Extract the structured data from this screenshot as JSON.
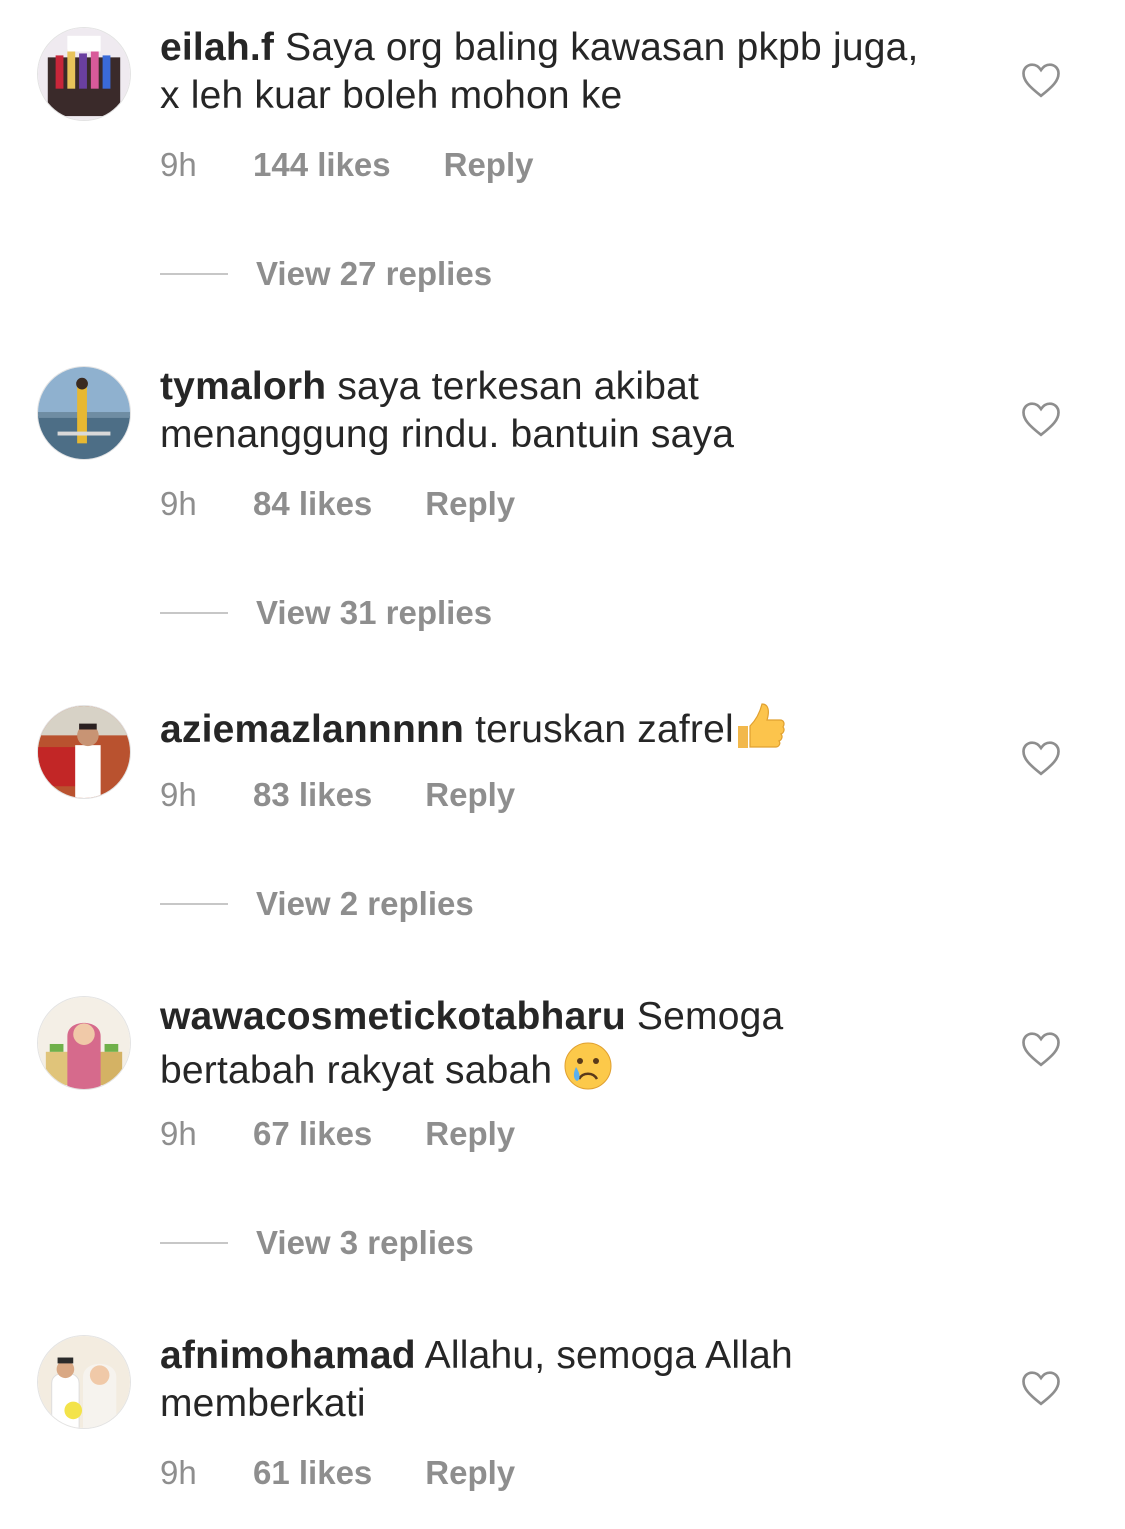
{
  "comments": [
    {
      "username": "eilah.f",
      "text": "Saya org baling kawasan pkpb juga, x leh kuar boleh mohon ke",
      "time": "9h",
      "likes": "144 likes",
      "reply": "Reply",
      "view_replies": "View 27 replies"
    },
    {
      "username": "tymalorh",
      "text": "saya terkesan akibat menanggung rindu. bantuin saya",
      "time": "9h",
      "likes": "84 likes",
      "reply": "Reply",
      "view_replies": "View 31 replies"
    },
    {
      "username": "aziemazlannnnn",
      "text": "teruskan zafrel",
      "emoji": "thumbs-up-emoji",
      "time": "9h",
      "likes": "83 likes",
      "reply": "Reply",
      "view_replies": "View 2 replies"
    },
    {
      "username": "wawacosmetickotabharu",
      "text": "Semoga bertabah rakyat sabah",
      "emoji": "crying-face-emoji",
      "time": "9h",
      "likes": "67 likes",
      "reply": "Reply",
      "view_replies": "View 3 replies"
    },
    {
      "username": "afnimohamad",
      "text": "Allahu, semoga Allah memberkati",
      "time": "9h",
      "likes": "61 likes",
      "reply": "Reply"
    }
  ],
  "icons": {
    "like": "heart-outline-icon"
  },
  "colors": {
    "text": "#262626",
    "meta": "#8e8e8e",
    "divider": "#c7c7c7"
  }
}
